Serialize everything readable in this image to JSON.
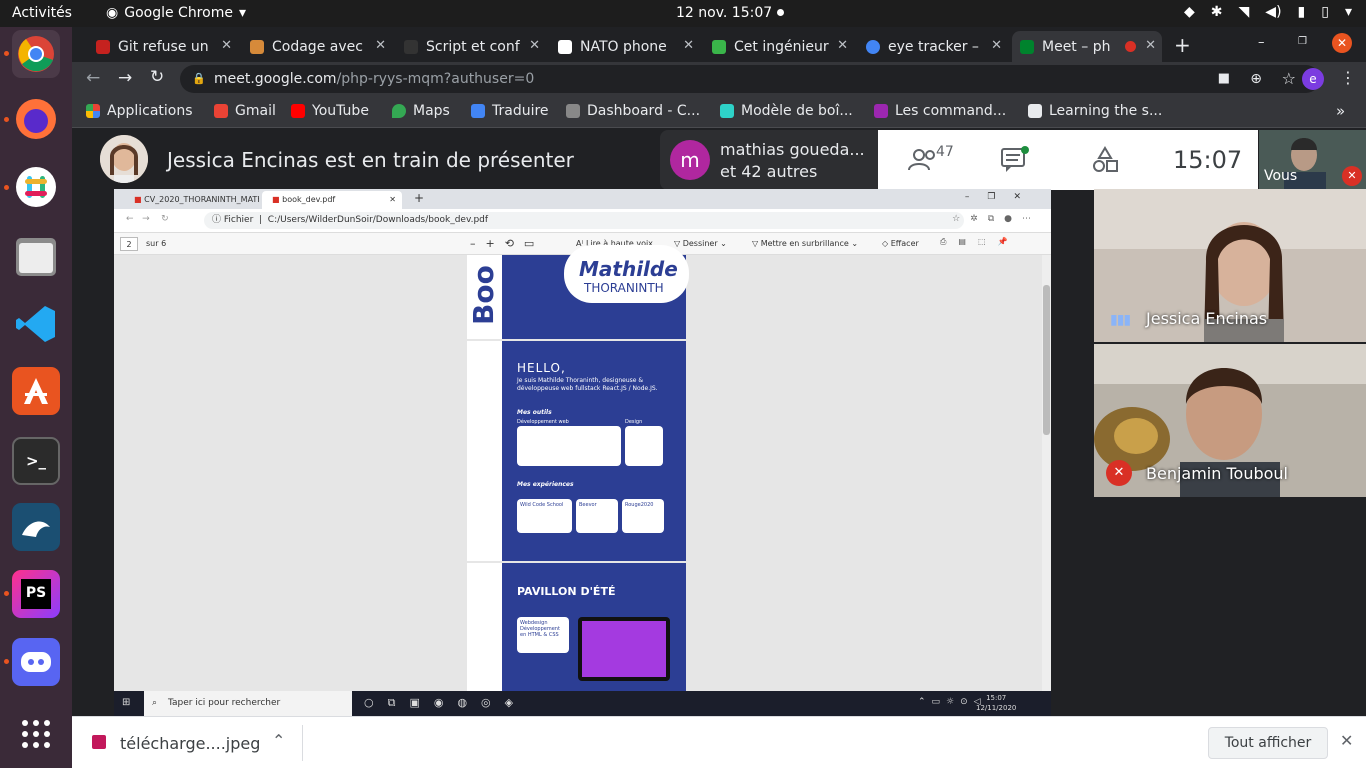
{
  "topbar": {
    "activities": "Activités",
    "app": "Google Chrome",
    "clock": "12 nov.  15:07"
  },
  "tabs": [
    {
      "title": "Git refuse un",
      "color": "#c5221f"
    },
    {
      "title": "Codage avec",
      "color": "#d68a3a"
    },
    {
      "title": "Script et conf",
      "color": "#333"
    },
    {
      "title": "NATO phone",
      "color": "#ffffff"
    },
    {
      "title": "Cet ingénieur",
      "color": "#3ab54a"
    },
    {
      "title": "eye tracker –",
      "color": "#4285f4"
    },
    {
      "title": "Meet – ph",
      "color": "#00832d"
    }
  ],
  "omnibox": {
    "url": "meet.google.com",
    "path": "/php-ryys-mqm?authuser=0",
    "profile": "e"
  },
  "bookmarks": [
    "Applications",
    "Gmail",
    "YouTube",
    "Maps",
    "Traduire",
    "Dashboard - C...",
    "Modèle de boî...",
    "Les command...",
    "Learning the s..."
  ],
  "meet": {
    "presenter": "Jessica Encinas est en train de présenter",
    "participant_line1": "mathias goueda...",
    "participant_line2": "et 42 autres",
    "participant_initial": "m",
    "people_count": "47",
    "time": "15:07",
    "self_label": "Vous",
    "tiles": [
      {
        "name": "Jessica Encinas"
      },
      {
        "name": "Benjamin Touboul"
      }
    ]
  },
  "shared": {
    "tab1": "CV_2020_THORANINTH_MATHI",
    "tab2": "book_dev.pdf",
    "file_label": "Fichier",
    "path": "C:/Users/WilderDunSoir/Downloads/book_dev.pdf",
    "page_num": "2",
    "page_total": "sur 6",
    "tools": [
      "Lire à haute voix",
      "Dessiner",
      "Mettre en surbrillance",
      "Effacer"
    ],
    "name1": "Mathilde",
    "name2": "THORANINTH",
    "boo": "Boo",
    "hello": "HELLO,",
    "intro": "Je suis Mathilde Thoraninth, designeuse & développeuse web fullstack React.JS / Node.JS.",
    "outils": "Mes outils",
    "dev_web": "Développement web",
    "design": "Design",
    "experiences": "Mes expériences",
    "exp1": "Wild Code School",
    "exp2": "Beevor",
    "exp3": "Rouge2020",
    "pavillon": "PAVILLON D'ÉTÉ",
    "webdesign": "Webdesign Développement en HTML & CSS",
    "search": "Taper ici pour rechercher",
    "win_time": "15:07",
    "win_date": "12/11/2020"
  },
  "downloads": {
    "file": "télécharge....jpeg",
    "show_all": "Tout afficher"
  }
}
